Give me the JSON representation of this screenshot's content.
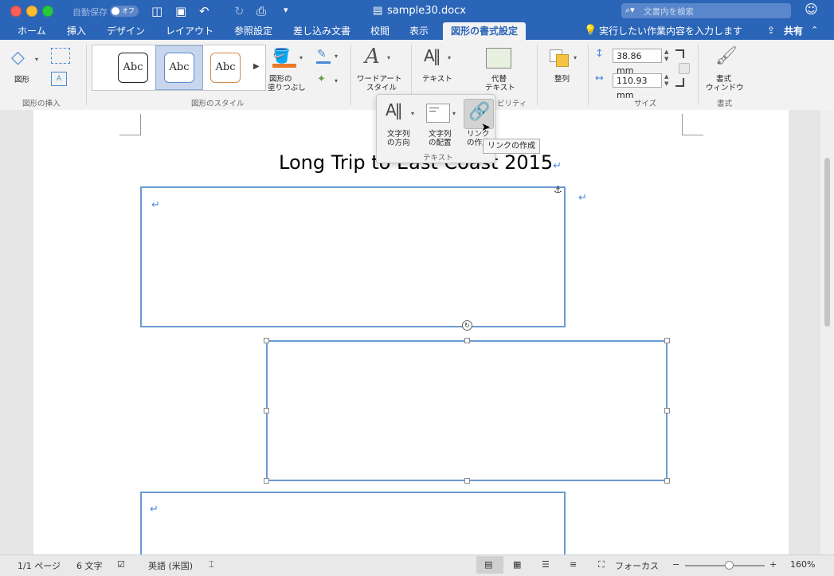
{
  "titlebar": {
    "autosave_label": "自動保存",
    "autosave_state": "オフ",
    "doc_title": "sample30.docx",
    "search_placeholder": "文書内を検索"
  },
  "tabs": [
    "ホーム",
    "挿入",
    "デザイン",
    "レイアウト",
    "参照設定",
    "差し込み文書",
    "校閲",
    "表示",
    "図形の書式設定"
  ],
  "active_tab": "図形の書式設定",
  "tell_me": "実行したい作業内容を入力します",
  "share": "共有",
  "ribbon": {
    "insert_shapes": {
      "shape_label": "図形",
      "group": "図形の挿入"
    },
    "styles": {
      "abc": [
        "Abc",
        "Abc",
        "Abc"
      ],
      "fill_label_1": "図形の",
      "fill_label_2": "塗りつぶし",
      "group": "図形のスタイル"
    },
    "wordart": {
      "label_1": "ワードアート",
      "label_2": "スタイル"
    },
    "text": {
      "label": "テキスト"
    },
    "alt": {
      "label_1": "代替",
      "label_2": "テキスト",
      "group_partial": "ビリティ"
    },
    "arrange": {
      "label": "整列"
    },
    "size": {
      "height": "38.86 mm",
      "width": "110.93 mm",
      "group": "サイズ"
    },
    "format_pane": {
      "label_1": "書式",
      "label_2": "ウィンドウ",
      "group": "書式"
    }
  },
  "text_panel": {
    "direction_1": "文字列",
    "direction_2": "の方向",
    "align_1": "文字列",
    "align_2": "の配置",
    "link_1": "リンク",
    "link_2": "の作成",
    "group": "テキスト",
    "tooltip": "リンクの作成"
  },
  "document": {
    "title": "Long Trip to East Coast 2015",
    "para_mark": "↵"
  },
  "statusbar": {
    "page": "1/1 ページ",
    "words": "6 文字",
    "language": "英語 (米国)",
    "focus": "フォーカス",
    "zoom": "160%"
  },
  "colors": {
    "accent": "#2b65b7",
    "shape_border": "#6a9bd3",
    "para_mark": "#4a90d9"
  }
}
